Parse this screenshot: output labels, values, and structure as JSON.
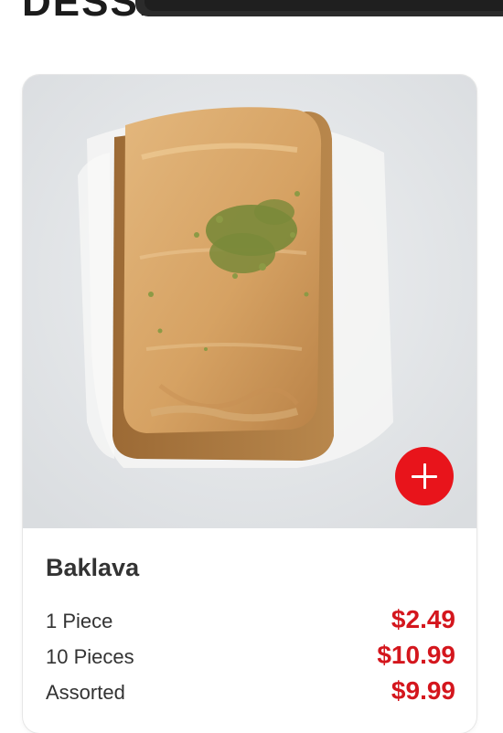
{
  "section": {
    "heading": "DESSERTS"
  },
  "product": {
    "name": "Baklava",
    "add_icon": "plus-icon",
    "options": [
      {
        "size": "1 Piece",
        "price": "$2.49"
      },
      {
        "size": "10 Pieces",
        "price": "$10.99"
      },
      {
        "size": "Assorted",
        "price": "$9.99"
      }
    ]
  },
  "colors": {
    "accent": "#e8141b",
    "price": "#d4161d",
    "text": "#333333"
  }
}
